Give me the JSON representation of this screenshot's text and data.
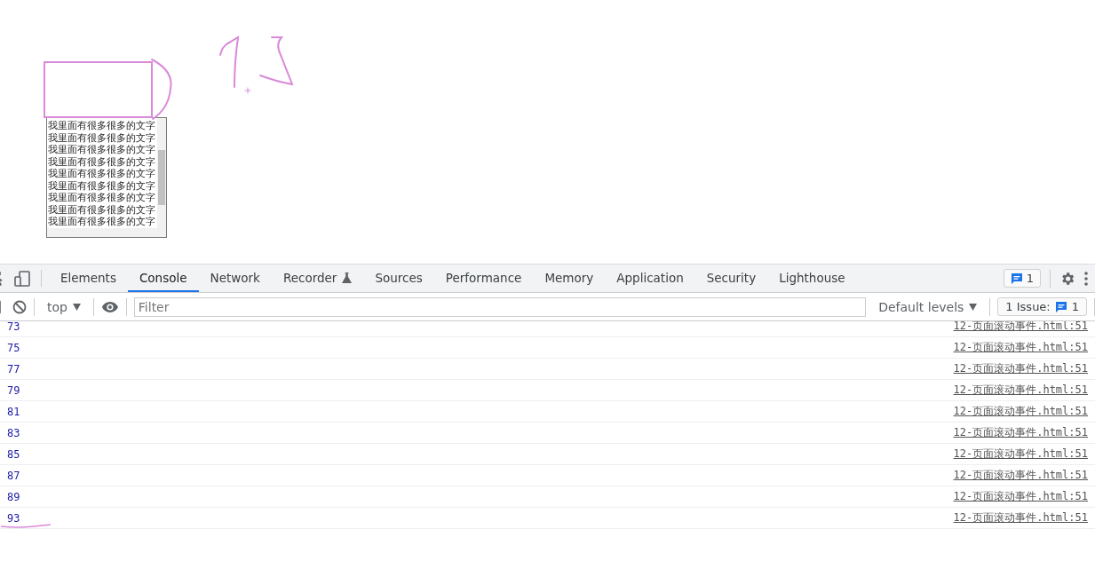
{
  "page": {
    "scroll_box": {
      "lines": [
        "我里面有很多很多的文字",
        "我里面有很多很多的文字",
        "我里面有很多很多的文字",
        "我里面有很多很多的文字",
        "我里面有很多很多的文字",
        "我里面有很多很多的文字",
        "我里面有很多很多的文字",
        "我里面有很多很多的文字",
        "我里面有很多很多的文字"
      ]
    }
  },
  "devtools": {
    "tabs": [
      {
        "label": "Elements",
        "selected": false,
        "kind": "plain"
      },
      {
        "label": "Console",
        "selected": true,
        "kind": "plain"
      },
      {
        "label": "Network",
        "selected": false,
        "kind": "plain"
      },
      {
        "label": "Recorder",
        "selected": false,
        "kind": "experimental"
      },
      {
        "label": "Sources",
        "selected": false,
        "kind": "plain"
      },
      {
        "label": "Performance",
        "selected": false,
        "kind": "plain"
      },
      {
        "label": "Memory",
        "selected": false,
        "kind": "plain"
      },
      {
        "label": "Application",
        "selected": false,
        "kind": "plain"
      },
      {
        "label": "Security",
        "selected": false,
        "kind": "plain"
      },
      {
        "label": "Lighthouse",
        "selected": false,
        "kind": "plain"
      }
    ],
    "issues_badge": "1",
    "toolbar": {
      "context": "top",
      "filter_placeholder": "Filter",
      "levels": "Default levels",
      "issues_label": "1 Issue:",
      "issues_count": "1"
    },
    "log": [
      {
        "value": "73",
        "source": "12-页面滚动事件.html:51"
      },
      {
        "value": "75",
        "source": "12-页面滚动事件.html:51"
      },
      {
        "value": "77",
        "source": "12-页面滚动事件.html:51"
      },
      {
        "value": "79",
        "source": "12-页面滚动事件.html:51"
      },
      {
        "value": "81",
        "source": "12-页面滚动事件.html:51"
      },
      {
        "value": "83",
        "source": "12-页面滚动事件.html:51"
      },
      {
        "value": "85",
        "source": "12-页面滚动事件.html:51"
      },
      {
        "value": "87",
        "source": "12-页面滚动事件.html:51"
      },
      {
        "value": "89",
        "source": "12-页面滚动事件.html:51"
      },
      {
        "value": "93",
        "source": "12-页面滚动事件.html:51"
      }
    ]
  }
}
